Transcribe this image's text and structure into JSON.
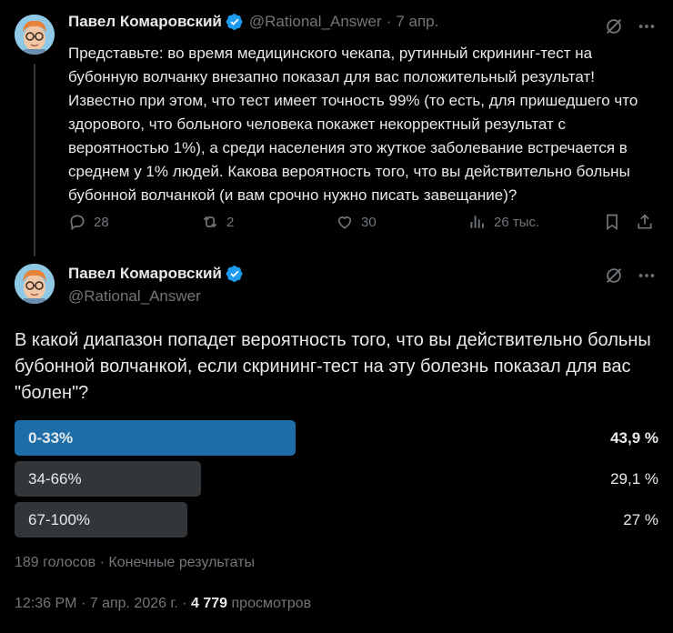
{
  "tweet1": {
    "author_name": "Павел Комаровский",
    "handle": "@Rational_Answer",
    "separator": "·",
    "date": "7 апр.",
    "text": "Представьте: во время медицинского чекапа, рутинный скрининг-тест на бубонную волчанку внезапно показал для вас положительный результат! Известно при этом, что тест имеет точность 99% (то есть, для пришедшего что здорового, что больного человека покажет некорректный результат с вероятностью 1%), а среди населения это жуткое заболевание встречается в среднем у 1% людей. Какова вероятность того, что вы действительно больны бубонной волчанкой (и вам срочно нужно писать завещание)?",
    "actions": {
      "replies": "28",
      "reposts": "2",
      "likes": "30",
      "views": "26 тыс."
    }
  },
  "tweet2": {
    "author_name": "Павел Комаровский",
    "handle": "@Rational_Answer",
    "poll": {
      "question": "В какой диапазон попадет вероятность того, что вы действительно больны бубонной волчанкой, если скрининг-тест на эту болезнь показал для вас \"болен\"?",
      "options": [
        {
          "label": "0-33%",
          "percent_text": "43,9 %",
          "share": 0.439,
          "winner": true
        },
        {
          "label": "34-66%",
          "percent_text": "29,1 %",
          "share": 0.291,
          "winner": false
        },
        {
          "label": "67-100%",
          "percent_text": "27 %",
          "share": 0.27,
          "winner": false
        }
      ],
      "votes": "189 голосов",
      "separator": "·",
      "status": "Конечные результаты"
    },
    "meta": {
      "time": "12:36 PM",
      "separator1": "·",
      "date": "7 апр. 2026 г.",
      "separator2": "·",
      "views_count": "4 779",
      "views_label": "просмотров"
    }
  },
  "colors": {
    "background": "#000000",
    "text": "#e7e9ea",
    "muted": "#71767b",
    "verified": "#1d9bf0",
    "winner_bar": "#1d6ea8",
    "other_bar": "#333639"
  },
  "icons": [
    "verified-badge-icon",
    "grok-icon",
    "more-icon",
    "reply-icon",
    "repost-icon",
    "like-icon",
    "views-icon",
    "bookmark-icon",
    "share-icon"
  ]
}
